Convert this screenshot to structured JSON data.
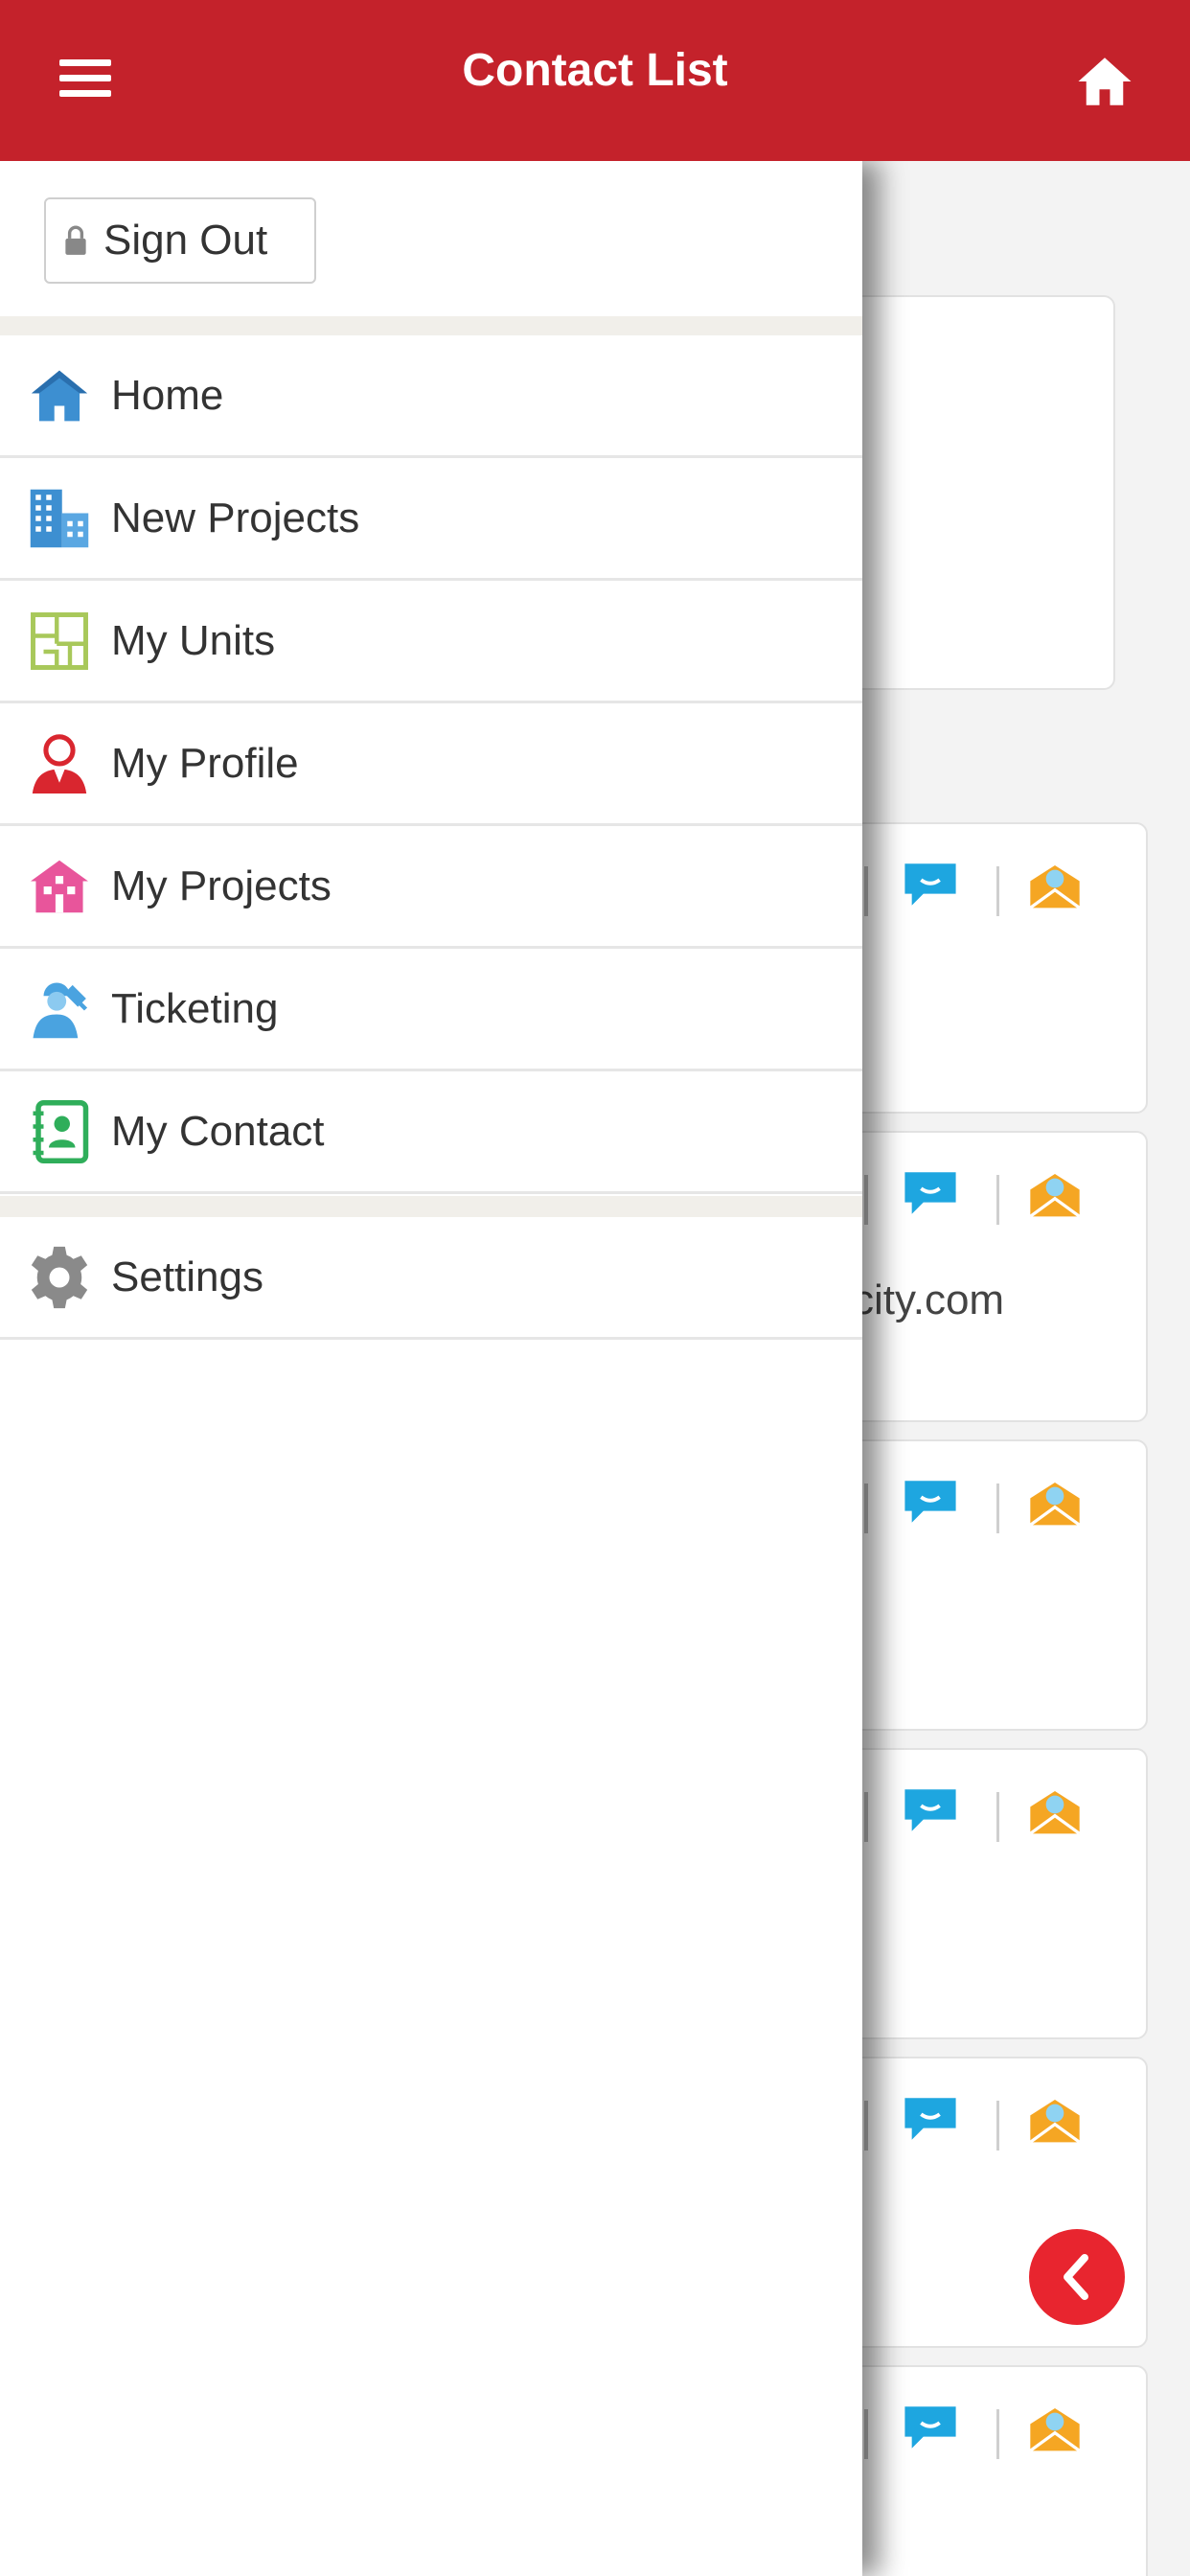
{
  "header": {
    "title": "Contact List"
  },
  "drawer": {
    "sign_out_label": "Sign Out",
    "items": [
      {
        "label": "Home",
        "icon": "home-icon"
      },
      {
        "label": "New Projects",
        "icon": "buildings-icon"
      },
      {
        "label": "My Units",
        "icon": "floorplan-icon"
      },
      {
        "label": "My Profile",
        "icon": "person-icon"
      },
      {
        "label": "My Projects",
        "icon": "house-icon"
      },
      {
        "label": "Ticketing",
        "icon": "worker-icon"
      },
      {
        "label": "My Contact",
        "icon": "contact-book-icon"
      }
    ],
    "settings_label": "Settings"
  },
  "background": {
    "email_fragment": "city.com"
  },
  "colors": {
    "header": "#c4222b",
    "chat": "#1ea6e0",
    "mail": "#f5a623",
    "back_button": "#e8252f"
  }
}
